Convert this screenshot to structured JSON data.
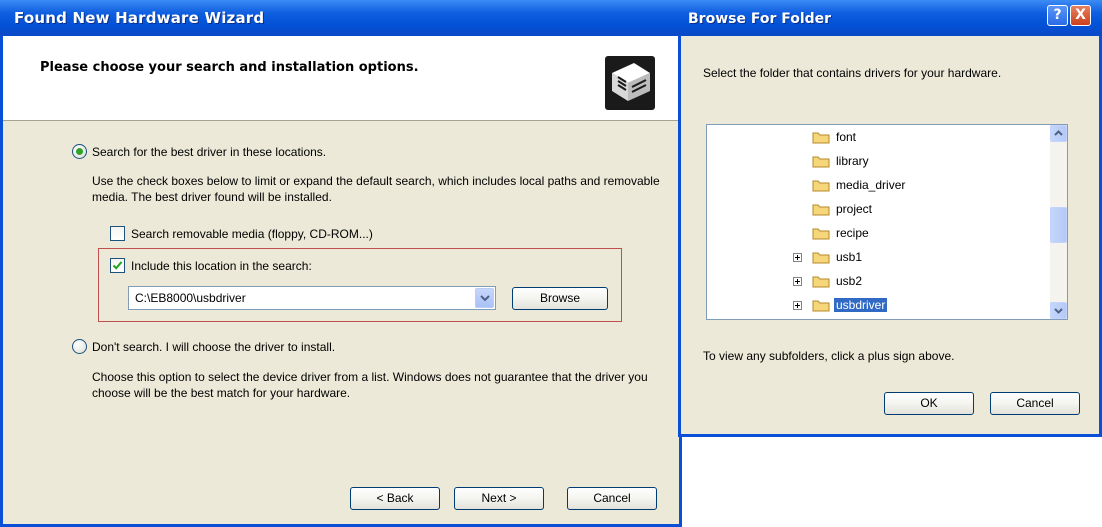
{
  "wizard": {
    "title": "Found New Hardware Wizard",
    "heading": "Please choose your search and installation options.",
    "option_search": {
      "label": "Search for the best driver in these locations.",
      "selected": true,
      "description": "Use the check boxes below to limit or expand the default search, which includes local paths and removable media. The best driver found will be installed."
    },
    "check_removable": {
      "label": "Search removable media (floppy, CD-ROM...)",
      "checked": false
    },
    "check_location": {
      "label": "Include this location in the search:",
      "checked": true
    },
    "location_path": "C:\\EB8000\\usbdriver",
    "browse_label": "Browse",
    "option_dont_search": {
      "label": "Don't search. I will choose the driver to install.",
      "selected": false,
      "description": "Choose this option to select the device driver from a list.  Windows does not guarantee that the driver you choose will be the best match for your hardware."
    },
    "buttons": {
      "back": "< Back",
      "next": "Next >",
      "cancel": "Cancel"
    }
  },
  "browse_dialog": {
    "title": "Browse For Folder",
    "help_glyph": "?",
    "close_glyph": "X",
    "instruction": "Select the folder that contains drivers for your hardware.",
    "folders": [
      {
        "name": "font",
        "expandable": false,
        "selected": false
      },
      {
        "name": "library",
        "expandable": false,
        "selected": false
      },
      {
        "name": "media_driver",
        "expandable": false,
        "selected": false
      },
      {
        "name": "project",
        "expandable": false,
        "selected": false
      },
      {
        "name": "recipe",
        "expandable": false,
        "selected": false
      },
      {
        "name": "usb1",
        "expandable": true,
        "selected": false
      },
      {
        "name": "usb2",
        "expandable": true,
        "selected": false
      },
      {
        "name": "usbdriver",
        "expandable": true,
        "selected": true
      }
    ],
    "hint": "To view any subfolders, click a plus sign above.",
    "ok_label": "OK",
    "cancel_label": "Cancel"
  },
  "colors": {
    "title_bar": "#0351d6",
    "dialog_face": "#ece9d8",
    "highlight_box": "#c0504d",
    "selection": "#316ac5",
    "folder": "#f5d67a"
  }
}
